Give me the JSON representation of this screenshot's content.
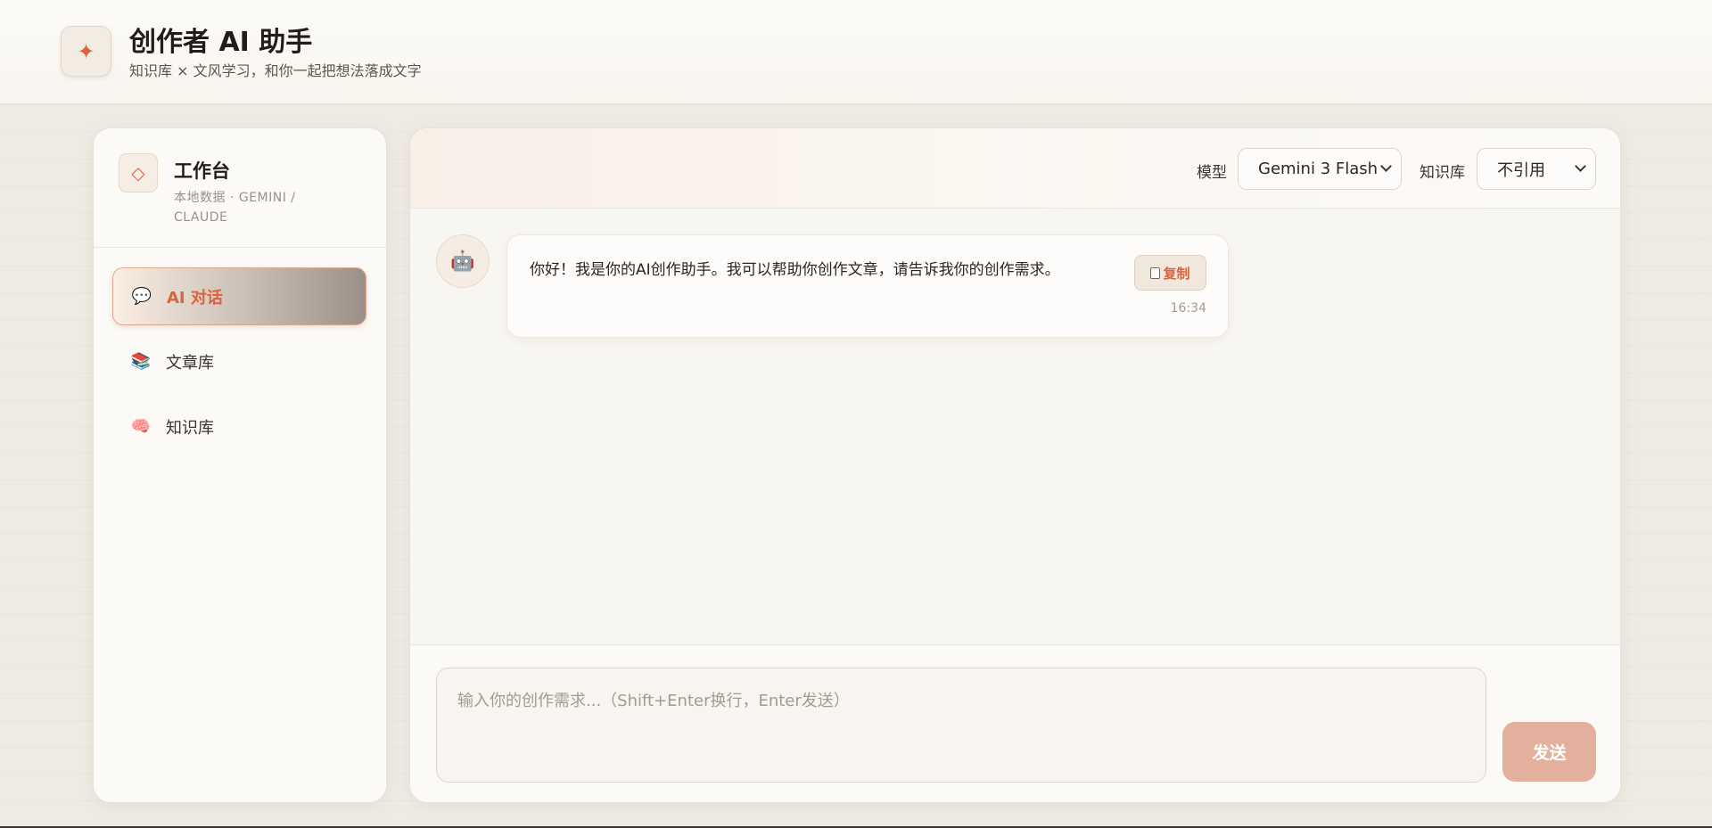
{
  "header": {
    "logo_icon": "sparkle-icon",
    "title": "创作者 AI 助手",
    "subtitle": "知识库 × 文风学习，和你一起把想法落成文字"
  },
  "sidebar": {
    "icon": "diamond-icon",
    "title": "工作台",
    "meta": "本地数据 · GEMINI / CLAUDE",
    "items": [
      {
        "label": "AI 对话",
        "icon": "speech-bubble-icon",
        "glyph": "💬",
        "active": true
      },
      {
        "label": "文章库",
        "icon": "books-icon",
        "glyph": "📚",
        "active": false
      },
      {
        "label": "知识库",
        "icon": "brain-icon",
        "glyph": "🧠",
        "active": false
      }
    ]
  },
  "toolbar": {
    "model_label": "模型",
    "model_value": "Gemini 3 Flash",
    "kb_label": "知识库",
    "kb_value": "不引用"
  },
  "chat": {
    "messages": [
      {
        "role": "assistant",
        "avatar": "robot-icon",
        "avatar_glyph": "🤖",
        "text": "你好！我是你的AI创作助手。我可以帮助你创作文章，请告诉我你的创作需求。",
        "copy_label": "复制",
        "time": "16:34"
      }
    ]
  },
  "composer": {
    "placeholder": "输入你的创作需求...（Shift+Enter换行，Enter发送）",
    "send_label": "发送"
  },
  "colors": {
    "accent": "#d9643f",
    "send_button": "#e3b09d",
    "background": "#efebe3"
  }
}
